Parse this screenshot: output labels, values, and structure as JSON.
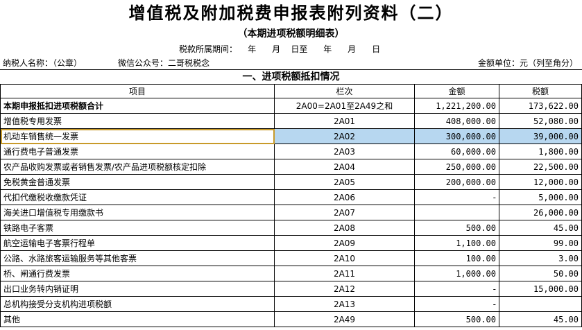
{
  "header": {
    "title": "增值税及附加税费申报表附列资料（二）",
    "subtitle": "（本期进项税额明细表）",
    "period_label": "税款所属期间：    年      月    日至      年      月      日",
    "taxpayer": "纳税人名称：（公章）",
    "wechat": "微信公众号：二哥税税念",
    "unit": "金额单位：元（列至角分）"
  },
  "section": {
    "title": "一、进项税额抵扣情况"
  },
  "table": {
    "columns": [
      "项目",
      "栏次",
      "金额",
      "税额"
    ],
    "rows": [
      {
        "item": "本期申报抵扣进项税额合计",
        "code": "2A00=2A01至2A49之和",
        "amount": "1,221,200.00",
        "tax": "173,622.00"
      },
      {
        "item": "增值税专用发票",
        "code": "2A01",
        "amount": "408,000.00",
        "tax": "52,080.00"
      },
      {
        "item": "机动车销售统一发票",
        "code": "2A02",
        "amount": "300,000.00",
        "tax": "39,000.00"
      },
      {
        "item": "通行费电子普通发票",
        "code": "2A03",
        "amount": "60,000.00",
        "tax": "1,800.00"
      },
      {
        "item": "农产品收购发票或者销售发票/农产品进项税额核定扣除",
        "code": "2A04",
        "amount": "250,000.00",
        "tax": "22,500.00"
      },
      {
        "item": "免税黄金普通发票",
        "code": "2A05",
        "amount": "200,000.00",
        "tax": "12,000.00"
      },
      {
        "item": "代扣代缴税收缴款凭证",
        "code": "2A06",
        "amount": "-",
        "tax": "5,000.00"
      },
      {
        "item": "海关进口增值税专用缴款书",
        "code": "2A07",
        "amount": "",
        "tax": "26,000.00"
      },
      {
        "item": "铁路电子客票",
        "code": "2A08",
        "amount": "500.00",
        "tax": "45.00"
      },
      {
        "item": "航空运输电子客票行程单",
        "code": "2A09",
        "amount": "1,100.00",
        "tax": "99.00"
      },
      {
        "item": "公路、水路旅客运输服务等其他客票",
        "code": "2A10",
        "amount": "100.00",
        "tax": "3.00"
      },
      {
        "item": "桥、闸通行费发票",
        "code": "2A11",
        "amount": "1,000.00",
        "tax": "50.00"
      },
      {
        "item": "出口业务转内销证明",
        "code": "2A12",
        "amount": "-",
        "tax": "15,000.00"
      },
      {
        "item": "总机构接受分支机构进项税额",
        "code": "2A13",
        "amount": "-",
        "tax": ""
      },
      {
        "item": "其他",
        "code": "2A49",
        "amount": "500.00",
        "tax": "45.00"
      }
    ]
  }
}
